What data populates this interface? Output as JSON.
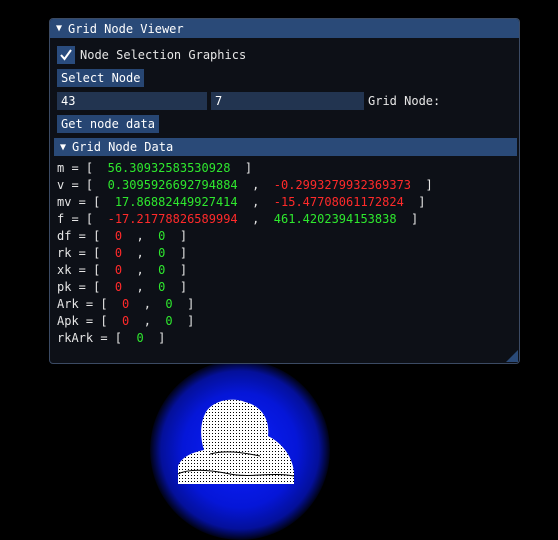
{
  "window": {
    "title": "Grid Node Viewer",
    "checkbox_label": "Node Selection Graphics",
    "checkbox_checked": true,
    "select_button": "Select Node",
    "input1": "43",
    "input2": "7",
    "grid_node_label": "Grid Node:",
    "get_button": "Get node data",
    "section_header": "Grid Node Data"
  },
  "rows": [
    {
      "name": "m",
      "values": [
        {
          "v": "56.30932583530928",
          "c": "g"
        }
      ]
    },
    {
      "name": "v",
      "values": [
        {
          "v": "0.3095926692794884",
          "c": "g"
        },
        {
          "v": "-0.2993279932369373",
          "c": "r"
        }
      ]
    },
    {
      "name": "mv",
      "values": [
        {
          "v": "17.86882449927414",
          "c": "g"
        },
        {
          "v": "-15.47708061172824",
          "c": "r"
        }
      ]
    },
    {
      "name": "f",
      "values": [
        {
          "v": "-17.21778826589994",
          "c": "r"
        },
        {
          "v": "461.4202394153838",
          "c": "g"
        }
      ]
    },
    {
      "name": "df",
      "values": [
        {
          "v": "0",
          "c": "r"
        },
        {
          "v": "0",
          "c": "g"
        }
      ]
    },
    {
      "name": "rk",
      "values": [
        {
          "v": "0",
          "c": "r"
        },
        {
          "v": "0",
          "c": "g"
        }
      ]
    },
    {
      "name": "xk",
      "values": [
        {
          "v": "0",
          "c": "r"
        },
        {
          "v": "0",
          "c": "g"
        }
      ]
    },
    {
      "name": "pk",
      "values": [
        {
          "v": "0",
          "c": "r"
        },
        {
          "v": "0",
          "c": "g"
        }
      ]
    },
    {
      "name": "Ark",
      "values": [
        {
          "v": "0",
          "c": "r"
        },
        {
          "v": "0",
          "c": "g"
        }
      ]
    },
    {
      "name": "Apk",
      "values": [
        {
          "v": "0",
          "c": "r"
        },
        {
          "v": "0",
          "c": "g"
        }
      ]
    },
    {
      "name": "rkArk",
      "values": [
        {
          "v": "0",
          "c": "g"
        }
      ]
    }
  ],
  "colors": {
    "green": "#2ee82e",
    "red": "#ff2a2a",
    "accent": "#2a4a78"
  }
}
